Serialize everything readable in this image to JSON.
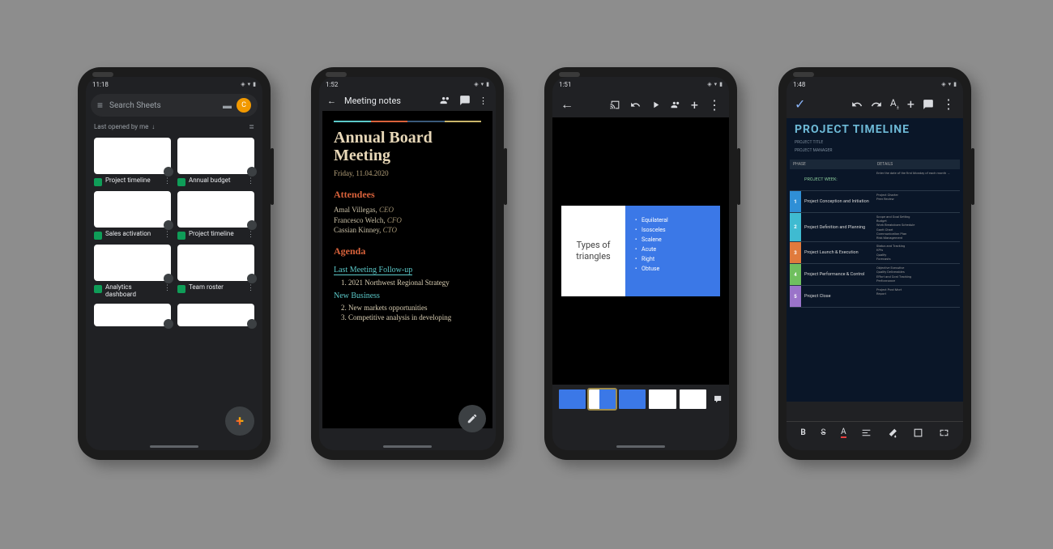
{
  "phone1": {
    "status_time": "11:18",
    "search_placeholder": "Search Sheets",
    "avatar_letter": "C",
    "sort_label": "Last opened by me",
    "files": [
      {
        "name": "Project timeline"
      },
      {
        "name": "Annual budget"
      },
      {
        "name": "Sales activation"
      },
      {
        "name": "Project timeline"
      },
      {
        "name": "Analytics dashboard"
      },
      {
        "name": "Team roster"
      }
    ]
  },
  "phone2": {
    "status_time": "1:52",
    "doc_title_bar": "Meeting notes",
    "doc_title": "Annual Board Meeting",
    "doc_date": "Friday, 11.04.2020",
    "attendees_heading": "Attendees",
    "attendees": [
      {
        "name": "Amal Villegas",
        "role": "CEO"
      },
      {
        "name": "Francesco Welch",
        "role": "CFO"
      },
      {
        "name": "Cassian Kinney",
        "role": "CTO"
      }
    ],
    "agenda_heading": "Agenda",
    "section1": "Last Meeting Follow-up",
    "section1_items": [
      "2021 Northwest Regional Strategy"
    ],
    "section2": "New Business",
    "section2_items": [
      "New markets opportunities",
      "Competitive analysis in developing"
    ]
  },
  "phone3": {
    "status_time": "1:51",
    "slide_left_title": "Types of triangles",
    "slide_right_items": [
      "Equilateral",
      "Isosceles",
      "Scalene",
      "Acute",
      "Right",
      "Obtuse"
    ]
  },
  "phone4": {
    "status_time": "1:48",
    "sheet_title": "PROJECT TIMELINE",
    "meta": [
      {
        "k": "PROJECT TITLE",
        "v": ""
      },
      {
        "k": "PROJECT MANAGER",
        "v": ""
      }
    ],
    "head_phase": "PHASE",
    "head_details": "DETAILS",
    "project_week_label": "PROJECT WEEK:",
    "project_week_note": "Enter the date of the first Monday of each month →",
    "phases": [
      {
        "n": "1",
        "color": "#2f8fd6",
        "name": "Project Conception and Initiation",
        "details": [
          "Project Charter",
          "Peer Review"
        ]
      },
      {
        "n": "2",
        "color": "#3fbbd1",
        "name": "Project Definition and Planning",
        "details": [
          "Scope and Goal Setting",
          "Budget",
          "Work Breakdown Schedule",
          "Gantt Chart",
          "Communication Plan",
          "Risk Management"
        ]
      },
      {
        "n": "3",
        "color": "#e07a3c",
        "name": "Project Launch & Execution",
        "details": [
          "Status and Tracking",
          "KPIs",
          "Quality",
          "Forecasts"
        ]
      },
      {
        "n": "4",
        "color": "#6fbf5e",
        "name": "Project Performance & Control",
        "details": [
          "Objective Executive",
          "Quality Deliverables",
          "Effort and Cost Tracking",
          "Performance"
        ]
      },
      {
        "n": "5",
        "color": "#9a73c9",
        "name": "Project Close",
        "details": [
          "Project Post Mort",
          "Report"
        ]
      }
    ],
    "toolbar": {
      "bold": "B",
      "strike": "S",
      "text": "A"
    }
  }
}
